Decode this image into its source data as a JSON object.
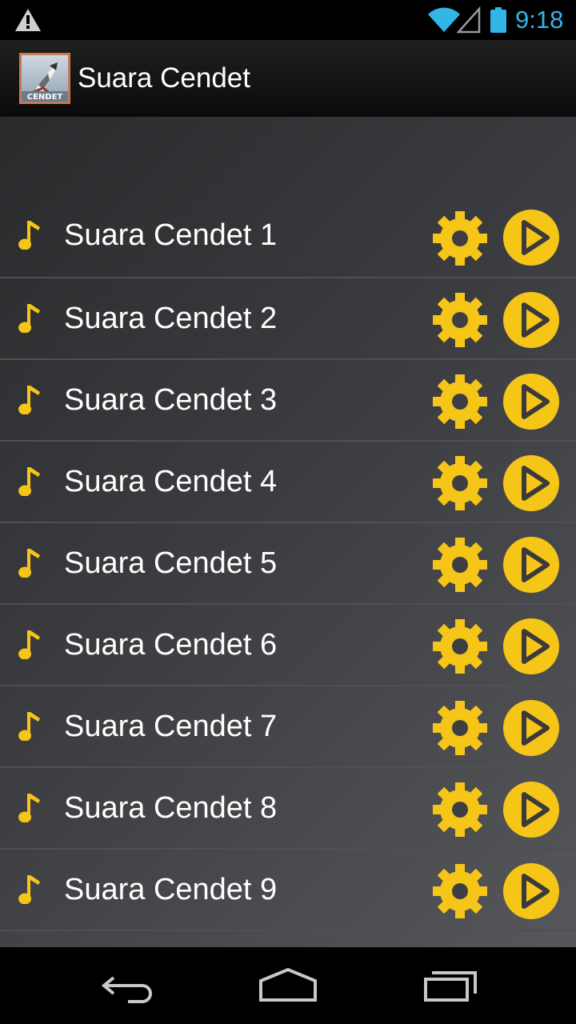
{
  "status_bar": {
    "time": "9:18",
    "icons": [
      "warning-icon",
      "wifi-icon",
      "signal-icon",
      "battery-icon"
    ],
    "time_color": "#33b5e5"
  },
  "app": {
    "title": "Suara Cendet",
    "icon_label": "CENDET"
  },
  "list": {
    "items": [
      {
        "label": "Suara Cendet 1"
      },
      {
        "label": "Suara Cendet 2"
      },
      {
        "label": "Suara Cendet 3"
      },
      {
        "label": "Suara Cendet 4"
      },
      {
        "label": "Suara Cendet 5"
      },
      {
        "label": "Suara Cendet 6"
      },
      {
        "label": "Suara Cendet 7"
      },
      {
        "label": "Suara Cendet 8"
      },
      {
        "label": "Suara Cendet 9"
      }
    ],
    "row_icons": [
      "music-note-icon",
      "gear-icon",
      "play-icon"
    ],
    "accent_color": "#f5c518"
  },
  "nav_bar": {
    "icons": [
      "back-icon",
      "home-icon",
      "recent-apps-icon"
    ]
  }
}
